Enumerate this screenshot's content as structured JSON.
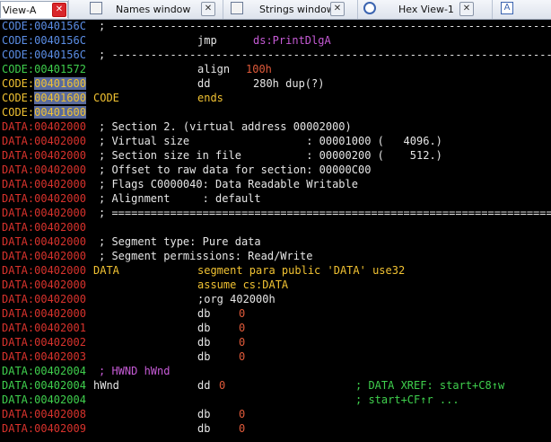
{
  "tabs": [
    {
      "label": "View-A",
      "active": true
    },
    {
      "label": "Names window"
    },
    {
      "label": "Strings window"
    },
    {
      "label": "Hex View-1"
    },
    {
      "label": "A"
    }
  ],
  "listing": [
    {
      "addr": "CODE:0040156C",
      "addr_color": "code",
      "parts": [
        {
          "col": "cmt",
          "text": "; -----------------------------------------------------------------------------"
        }
      ]
    },
    {
      "addr": "CODE:0040156C",
      "addr_color": "code",
      "parts": [
        {
          "col": "ins",
          "text": "jmp"
        },
        {
          "col": "op",
          "text": "ds:PrintDlgA",
          "cls": "ref"
        }
      ]
    },
    {
      "addr": "CODE:0040156C",
      "addr_color": "code",
      "parts": [
        {
          "col": "cmt",
          "text": "; -----------------------------------------------------------------------------"
        }
      ]
    },
    {
      "addr": "CODE:00401572",
      "addr_color": "codeg",
      "parts": [
        {
          "col": "ins",
          "text": "align"
        },
        {
          "col": "op",
          "text": "100h",
          "cls": "num",
          "offset": -8
        }
      ]
    },
    {
      "addr": "CODE:00401600",
      "addr_color": "codey",
      "hl": true,
      "parts": [
        {
          "col": "ins",
          "text": "dd"
        },
        {
          "col": "op",
          "text": "280h dup(?)"
        }
      ]
    },
    {
      "addr": "CODE:00401600",
      "addr_color": "codey",
      "hl": true,
      "parts": [
        {
          "col": "lbl",
          "text": "CODE"
        },
        {
          "col": "ins",
          "text": "ends",
          "cls": "kw-y"
        }
      ]
    },
    {
      "addr": "CODE:00401600",
      "addr_color": "codey",
      "hl": true,
      "parts": []
    },
    {
      "addr": "DATA:00402000",
      "addr_color": "data",
      "parts": [
        {
          "col": "cmt",
          "text": "; Section 2. (virtual address 00002000)"
        }
      ]
    },
    {
      "addr": "DATA:00402000",
      "addr_color": "data",
      "parts": [
        {
          "col": "cmt",
          "text": "; Virtual size                  : 00001000 (   4096.)"
        }
      ]
    },
    {
      "addr": "DATA:00402000",
      "addr_color": "data",
      "parts": [
        {
          "col": "cmt",
          "text": "; Section size in file          : 00000200 (    512.)"
        }
      ]
    },
    {
      "addr": "DATA:00402000",
      "addr_color": "data",
      "parts": [
        {
          "col": "cmt",
          "text": "; Offset to raw data for section: 00000C00"
        }
      ]
    },
    {
      "addr": "DATA:00402000",
      "addr_color": "data",
      "parts": [
        {
          "col": "cmt",
          "text": "; Flags C0000040: Data Readable Writable"
        }
      ]
    },
    {
      "addr": "DATA:00402000",
      "addr_color": "data",
      "parts": [
        {
          "col": "cmt",
          "text": "; Alignment     : default"
        }
      ]
    },
    {
      "addr": "DATA:00402000",
      "addr_color": "data",
      "parts": [
        {
          "col": "cmt",
          "text": "; ================================================================================="
        }
      ]
    },
    {
      "addr": "DATA:00402000",
      "addr_color": "data",
      "parts": []
    },
    {
      "addr": "DATA:00402000",
      "addr_color": "data",
      "parts": [
        {
          "col": "cmt",
          "text": "; Segment type: Pure data"
        }
      ]
    },
    {
      "addr": "DATA:00402000",
      "addr_color": "data",
      "parts": [
        {
          "col": "cmt",
          "text": "; Segment permissions: Read/Write"
        }
      ]
    },
    {
      "addr": "DATA:00402000",
      "addr_color": "data",
      "parts": [
        {
          "col": "lbl",
          "text": "DATA"
        },
        {
          "col": "ins",
          "text": "segment para public 'DATA' use32",
          "cls": "kw-y"
        }
      ]
    },
    {
      "addr": "DATA:00402000",
      "addr_color": "data",
      "parts": [
        {
          "col": "ins",
          "text": "assume cs:DATA",
          "cls": "kw-y"
        }
      ]
    },
    {
      "addr": "DATA:00402000",
      "addr_color": "data",
      "parts": [
        {
          "col": "ins",
          "text": ";org 402000h"
        }
      ]
    },
    {
      "addr": "DATA:00402000",
      "addr_color": "data",
      "parts": [
        {
          "col": "ins",
          "text": "db"
        },
        {
          "col": "op",
          "text": "0",
          "cls": "num",
          "offset": -16
        }
      ]
    },
    {
      "addr": "DATA:00402001",
      "addr_color": "data",
      "parts": [
        {
          "col": "ins",
          "text": "db"
        },
        {
          "col": "op",
          "text": "0",
          "cls": "num",
          "offset": -16
        }
      ]
    },
    {
      "addr": "DATA:00402002",
      "addr_color": "data",
      "parts": [
        {
          "col": "ins",
          "text": "db"
        },
        {
          "col": "op",
          "text": "0",
          "cls": "num",
          "offset": -16
        }
      ]
    },
    {
      "addr": "DATA:00402003",
      "addr_color": "data",
      "parts": [
        {
          "col": "ins",
          "text": "db"
        },
        {
          "col": "op",
          "text": "0",
          "cls": "num",
          "offset": -16
        }
      ]
    },
    {
      "addr": "DATA:00402004",
      "addr_color": "datag",
      "parts": [
        {
          "col": "cmt",
          "text": "; HWND hWnd",
          "cls": "ref"
        }
      ]
    },
    {
      "addr": "DATA:00402004",
      "addr_color": "datag",
      "parts": [
        {
          "col": "lbl",
          "text": "hWnd",
          "cls": "w"
        },
        {
          "col": "ins",
          "text": "dd"
        },
        {
          "col": "op",
          "text": "0",
          "cls": "num",
          "offset": -38
        },
        {
          "col": "x",
          "text": "; DATA XREF: start+C8↑w",
          "cls": "xref"
        }
      ]
    },
    {
      "addr": "DATA:00402004",
      "addr_color": "datag",
      "parts": [
        {
          "col": "x",
          "text": "; start+CF↑r ...",
          "cls": "xref"
        }
      ]
    },
    {
      "addr": "DATA:00402008",
      "addr_color": "data",
      "parts": [
        {
          "col": "ins",
          "text": "db"
        },
        {
          "col": "op",
          "text": "0",
          "cls": "num",
          "offset": -16
        }
      ]
    },
    {
      "addr": "DATA:00402009",
      "addr_color": "data",
      "parts": [
        {
          "col": "ins",
          "text": "db"
        },
        {
          "col": "op",
          "text": "0",
          "cls": "num",
          "offset": -16
        }
      ]
    }
  ],
  "colors": {
    "code": "#5b8ee6",
    "data": "#d8322c",
    "green": "#3fcf4d",
    "yellow": "#f1c232",
    "background": "#000000"
  }
}
